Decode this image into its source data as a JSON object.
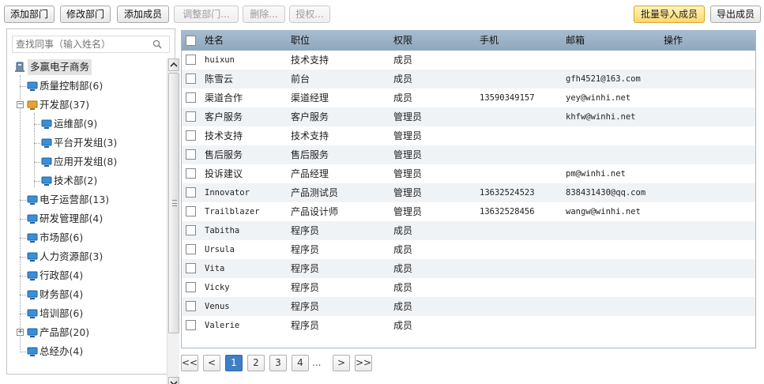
{
  "toolbar": {
    "add_dept": "添加部门",
    "edit_dept": "修改部门",
    "add_member": "添加成员",
    "adjust_dept": "调整部门...",
    "delete": "删除...",
    "authorize": "授权...",
    "batch_import": "批量导入成员",
    "export": "导出成员"
  },
  "search": {
    "placeholder": "查找同事（输入姓名）"
  },
  "tree": {
    "root": "多赢电子商务",
    "nodes": [
      {
        "name": "质量控制部",
        "count": "(6)"
      },
      {
        "name": "开发部",
        "count": "(37)"
      },
      {
        "name": "运维部",
        "count": "(9)"
      },
      {
        "name": "平台开发组",
        "count": "(3)"
      },
      {
        "name": "应用开发组",
        "count": "(8)"
      },
      {
        "name": "技术部",
        "count": "(2)"
      },
      {
        "name": "电子运营部",
        "count": "(13)"
      },
      {
        "name": "研发管理部",
        "count": "(4)"
      },
      {
        "name": "市场部",
        "count": "(6)"
      },
      {
        "name": "人力资源部",
        "count": "(3)"
      },
      {
        "name": "行政部",
        "count": "(4)"
      },
      {
        "name": "财务部",
        "count": "(4)"
      },
      {
        "name": "培训部",
        "count": "(6)"
      },
      {
        "name": "产品部",
        "count": "(20)"
      },
      {
        "name": "总经办",
        "count": "(4)"
      }
    ]
  },
  "grid": {
    "columns": [
      "姓名",
      "职位",
      "权限",
      "手机",
      "邮箱",
      "操作"
    ],
    "rows": [
      [
        "huixun",
        "技术支持",
        "成员",
        "",
        ""
      ],
      [
        "陈雪云",
        "前台",
        "成员",
        "",
        "gfh4521@163.com"
      ],
      [
        "渠道合作",
        "渠道经理",
        "成员",
        "13590349157",
        "yey@winhi.net"
      ],
      [
        "客户服务",
        "客户服务",
        "管理员",
        "",
        "khfw@winhi.net"
      ],
      [
        "技术支持",
        "技术支持",
        "管理员",
        "",
        ""
      ],
      [
        "售后服务",
        "售后服务",
        "管理员",
        "",
        ""
      ],
      [
        "投诉建议",
        "产品经理",
        "管理员",
        "",
        "pm@winhi.net"
      ],
      [
        "Innovator",
        "产品测试员",
        "管理员",
        "13632524523",
        "838431430@qq.com"
      ],
      [
        "Trailblazer",
        "产品设计师",
        "管理员",
        "13632528456",
        "wangw@winhi.net"
      ],
      [
        "Tabitha",
        "程序员",
        "成员",
        "",
        ""
      ],
      [
        "Ursula",
        "程序员",
        "成员",
        "",
        ""
      ],
      [
        "Vita",
        "程序员",
        "成员",
        "",
        ""
      ],
      [
        "Vicky",
        "程序员",
        "成员",
        "",
        ""
      ],
      [
        "Venus",
        "程序员",
        "成员",
        "",
        ""
      ],
      [
        "Valerie",
        "程序员",
        "成员",
        "",
        ""
      ]
    ]
  },
  "pager": {
    "first": "<<",
    "prev": "<",
    "pages": [
      "1",
      "2",
      "3",
      "4"
    ],
    "ellipsis": "...",
    "next": ">",
    "last": ">>",
    "current": "1"
  },
  "colors": {
    "header_bg": "#9bb1c6",
    "active_page": "#3f7fc4",
    "primary_button": "#fcd86a",
    "alt_row": "#f0f3f6"
  }
}
